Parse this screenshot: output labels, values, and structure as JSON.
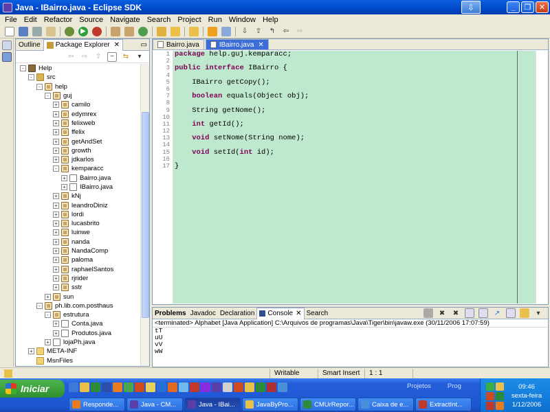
{
  "window": {
    "title": "Java - IBairro.java - Eclipse SDK"
  },
  "menu": [
    "File",
    "Edit",
    "Refactor",
    "Source",
    "Navigate",
    "Search",
    "Project",
    "Run",
    "Window",
    "Help"
  ],
  "explorer": {
    "tabs": [
      {
        "label": "Outline"
      },
      {
        "label": "Package Explorer"
      }
    ],
    "tree": [
      {
        "indent": 0,
        "toggle": "-",
        "icon": "proj",
        "label": "Help"
      },
      {
        "indent": 1,
        "toggle": "-",
        "icon": "src",
        "label": "src"
      },
      {
        "indent": 2,
        "toggle": "-",
        "icon": "pkg",
        "label": "help"
      },
      {
        "indent": 3,
        "toggle": "-",
        "icon": "pkg",
        "label": "guj"
      },
      {
        "indent": 4,
        "toggle": "+",
        "icon": "pkg",
        "label": "camilo"
      },
      {
        "indent": 4,
        "toggle": "+",
        "icon": "pkg",
        "label": "edymrex"
      },
      {
        "indent": 4,
        "toggle": "+",
        "icon": "pkg",
        "label": "felixweb"
      },
      {
        "indent": 4,
        "toggle": "+",
        "icon": "pkg",
        "label": "ffelix"
      },
      {
        "indent": 4,
        "toggle": "+",
        "icon": "pkg",
        "label": "getAndSet"
      },
      {
        "indent": 4,
        "toggle": "+",
        "icon": "pkg",
        "label": "growth"
      },
      {
        "indent": 4,
        "toggle": "+",
        "icon": "pkg",
        "label": "jdkarlos"
      },
      {
        "indent": 4,
        "toggle": "-",
        "icon": "pkg",
        "label": "kemparacc"
      },
      {
        "indent": 5,
        "toggle": "+",
        "icon": "file",
        "label": "Bairro.java"
      },
      {
        "indent": 5,
        "toggle": "+",
        "icon": "file",
        "label": "IBairro.java"
      },
      {
        "indent": 4,
        "toggle": "+",
        "icon": "pkg",
        "label": "kNj"
      },
      {
        "indent": 4,
        "toggle": "+",
        "icon": "pkg",
        "label": "leandroDiniz"
      },
      {
        "indent": 4,
        "toggle": "+",
        "icon": "pkg",
        "label": "lordi"
      },
      {
        "indent": 4,
        "toggle": "+",
        "icon": "pkg",
        "label": "lucasbrito"
      },
      {
        "indent": 4,
        "toggle": "+",
        "icon": "pkg",
        "label": "luinwe"
      },
      {
        "indent": 4,
        "toggle": "+",
        "icon": "pkg",
        "label": "nanda"
      },
      {
        "indent": 4,
        "toggle": "+",
        "icon": "pkg",
        "label": "NandaComp"
      },
      {
        "indent": 4,
        "toggle": "+",
        "icon": "pkg",
        "label": "paloma"
      },
      {
        "indent": 4,
        "toggle": "+",
        "icon": "pkg",
        "label": "raphaelSantos"
      },
      {
        "indent": 4,
        "toggle": "+",
        "icon": "pkg",
        "label": "rjrider"
      },
      {
        "indent": 4,
        "toggle": "+",
        "icon": "pkg",
        "label": "sstr"
      },
      {
        "indent": 3,
        "toggle": "+",
        "icon": "pkg",
        "label": "sun"
      },
      {
        "indent": 2,
        "toggle": "-",
        "icon": "pkg",
        "label": "ph.lib.com.posthaus"
      },
      {
        "indent": 3,
        "toggle": "-",
        "icon": "pkg",
        "label": "estrutura"
      },
      {
        "indent": 4,
        "toggle": "+",
        "icon": "file",
        "label": "Conta.java"
      },
      {
        "indent": 4,
        "toggle": "+",
        "icon": "file",
        "label": "Produtos.java"
      },
      {
        "indent": 3,
        "toggle": "+",
        "icon": "file",
        "label": "lojaPh.java"
      },
      {
        "indent": 1,
        "toggle": "+",
        "icon": "folder",
        "label": "META-INF"
      },
      {
        "indent": 1,
        "toggle": "",
        "icon": "folder",
        "label": "MsnFiles"
      }
    ]
  },
  "editor": {
    "tabs": [
      {
        "label": "Bairro.java"
      },
      {
        "label": "IBairro.java"
      }
    ],
    "lines": [
      [
        {
          "t": "package",
          "k": true
        },
        {
          "t": " help.guj.kemparacc;"
        }
      ],
      [],
      [
        {
          "t": "public",
          "k": true
        },
        {
          "t": " "
        },
        {
          "t": "interface",
          "k": true
        },
        {
          "t": " IBairro {"
        }
      ],
      [],
      [
        {
          "t": "    IBairro getCopy();"
        }
      ],
      [],
      [
        {
          "t": "    "
        },
        {
          "t": "boolean",
          "k": true
        },
        {
          "t": " equals(Object obj);"
        }
      ],
      [],
      [
        {
          "t": "    String getNome();"
        }
      ],
      [],
      [
        {
          "t": "    "
        },
        {
          "t": "int",
          "k": true
        },
        {
          "t": " getId();"
        }
      ],
      [],
      [
        {
          "t": "    "
        },
        {
          "t": "void",
          "k": true
        },
        {
          "t": " setNome(String nome);"
        }
      ],
      [],
      [
        {
          "t": "    "
        },
        {
          "t": "void",
          "k": true
        },
        {
          "t": " setId("
        },
        {
          "t": "int",
          "k": true
        },
        {
          "t": " id);"
        }
      ],
      [],
      [
        {
          "t": "}"
        }
      ]
    ]
  },
  "console": {
    "tabs": [
      "Problems",
      "Javadoc",
      "Declaration",
      "Console",
      "Search"
    ],
    "terminated": "<terminated> Alphabet [Java Application] C:\\Arquivos de programas\\Java\\Tiger\\bin\\javaw.exe (30/11/2006 17:07:59)",
    "output": [
      "tT",
      "uU",
      "vV",
      "wW"
    ]
  },
  "status": {
    "writable": "Writable",
    "insert_mode": "Smart Insert",
    "position": "1 : 1"
  },
  "taskbar": {
    "start": "Iniciar",
    "tasks": [
      "Responde...",
      "Java - CM...",
      "Java - IBai...",
      "JavaByPro...",
      "CMUrRepor...",
      "Caixa de e...",
      "ExtractInt..."
    ],
    "lang_left": "Projetos",
    "lang_right": "Prog",
    "clock_time": "09:46",
    "clock_day": "sexta-feira",
    "clock_date": "1/12/2006"
  }
}
